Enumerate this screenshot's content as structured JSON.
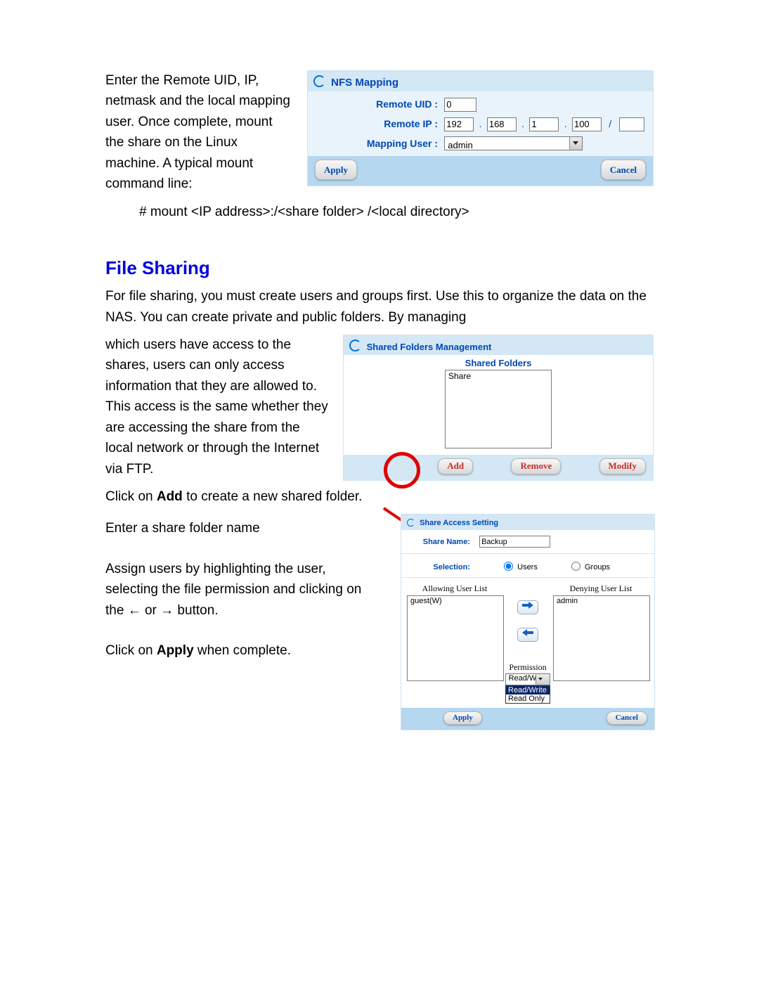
{
  "intro_para": "Enter the Remote UID, IP, netmask and the local mapping user. Once complete, mount the share on the Linux machine. A typical mount command line:",
  "mount_cmd": "# mount <IP address>:/<share folder> /<local directory>",
  "heading_fs": "File Sharing",
  "fs_para1": "For file sharing, you must create users and groups first. Use this to organize the data on the NAS. You can create private and public folders. By managing",
  "fs_para2": "which users have access to the shares, users can only access information that they are allowed to. This access is the same whether they are accessing the share from the local network or through the Internet via FTP.",
  "fs_click_add_pre": "Click on ",
  "fs_click_add_bold": "Add",
  "fs_click_add_post": " to create a new shared folder.",
  "sas_t1": "Enter a share folder name",
  "sas_t2_a": "Assign users by highlighting the user, selecting the file permission and clicking on the ",
  "sas_t2_left": "←",
  "sas_t2_or": " or ",
  "sas_t2_right": "→",
  "sas_t2_b": " button.",
  "sas_t3_a": "Click on ",
  "sas_t3_bold": "Apply",
  "sas_t3_b": " when complete.",
  "nfs": {
    "title": "NFS Mapping",
    "uid_label": "Remote UID :",
    "uid_value": "0",
    "ip_label": "Remote IP :",
    "ip": [
      "192",
      "168",
      "1",
      "100"
    ],
    "mask": "",
    "slash": "/",
    "user_label": "Mapping User :",
    "user_value": "admin",
    "apply": "Apply",
    "cancel": "Cancel"
  },
  "sfm": {
    "title": "Shared Folders Management",
    "subhead": "Shared Folders",
    "item0": "Share",
    "add": "Add",
    "remove": "Remove",
    "modify": "Modify"
  },
  "sas": {
    "title": "Share Access Setting",
    "name_label": "Share Name:",
    "name_value": "Backup",
    "sel_label": "Selection:",
    "users": "Users",
    "groups": "Groups",
    "allow_head": "Allowing User List",
    "deny_head": "Denying User List",
    "allow_item0": "guest(W)",
    "deny_item0": "admin",
    "perm_label": "Permission",
    "perm_sel": "Read/Write",
    "perm_opt0": "Read/Write",
    "perm_opt1": "Read Only",
    "apply": "Apply",
    "cancel": "Cancel"
  }
}
